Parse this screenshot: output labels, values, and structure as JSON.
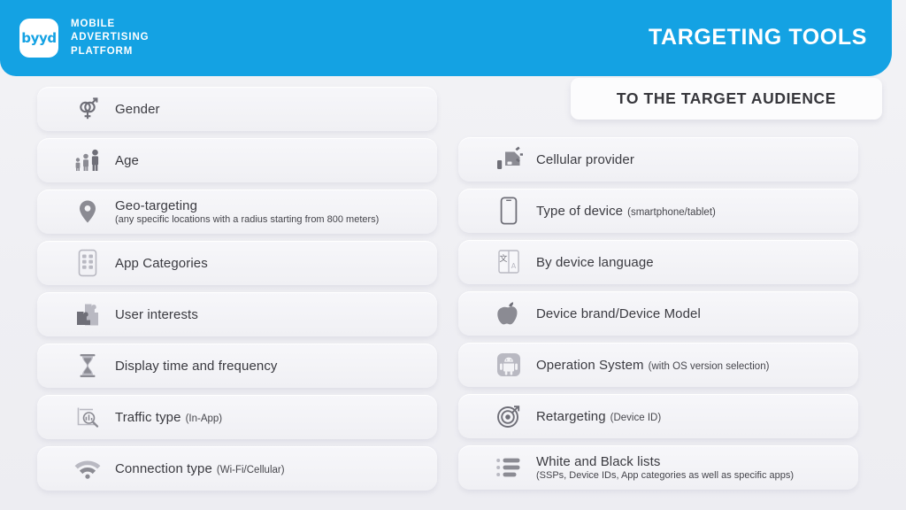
{
  "header": {
    "logo_word": "byyd",
    "brand_line_1": "MOBILE",
    "brand_line_2": "ADVERTISING",
    "brand_line_3": "PLATFORM",
    "title": "TARGETING TOOLS",
    "accent_color": "#14a2e3",
    "badge_text": "TO THE TARGET AUDIENCE"
  },
  "left_column": [
    {
      "icon": "gender-symbols-icon",
      "title": "Gender",
      "inline": "",
      "sub": ""
    },
    {
      "icon": "people-ages-icon",
      "title": "Age",
      "inline": "",
      "sub": ""
    },
    {
      "icon": "map-pin-icon",
      "title": "Geo-targeting",
      "inline": "",
      "sub": "(any specific locations with a radius starting from 800 meters)"
    },
    {
      "icon": "phone-app-grid-icon",
      "title": "App Categories",
      "inline": "",
      "sub": ""
    },
    {
      "icon": "puzzle-piece-icon",
      "title": "User interests",
      "inline": "",
      "sub": ""
    },
    {
      "icon": "hourglass-icon",
      "title": "Display time and frequency",
      "inline": "",
      "sub": ""
    },
    {
      "icon": "magnifier-chart-icon",
      "title": "Traffic type",
      "inline": "(In-App)",
      "sub": ""
    },
    {
      "icon": "wifi-signal-icon",
      "title": "Connection type",
      "inline": "(Wi-Fi/Cellular)",
      "sub": ""
    }
  ],
  "right_column": [
    {
      "icon": "sim-card-antenna-icon",
      "title": "Cellular provider",
      "inline": "",
      "sub": ""
    },
    {
      "icon": "smartphone-icon",
      "title": "Type of device",
      "inline": "(smartphone/tablet)",
      "sub": ""
    },
    {
      "icon": "translate-language-icon",
      "title": "By device language",
      "inline": "",
      "sub": ""
    },
    {
      "icon": "apple-fruit-icon",
      "title": "Device brand/Device Model",
      "inline": "",
      "sub": ""
    },
    {
      "icon": "android-robot-icon",
      "title": "Operation System",
      "inline": "(with OS version selection)",
      "sub": ""
    },
    {
      "icon": "target-bullseye-icon",
      "title": "Retargeting",
      "inline": "(Device ID)",
      "sub": ""
    },
    {
      "icon": "bulleted-list-icon",
      "title": "White and Black lists",
      "inline": "",
      "sub": "(SSPs, Device IDs, App categories as well as specific apps)"
    }
  ]
}
